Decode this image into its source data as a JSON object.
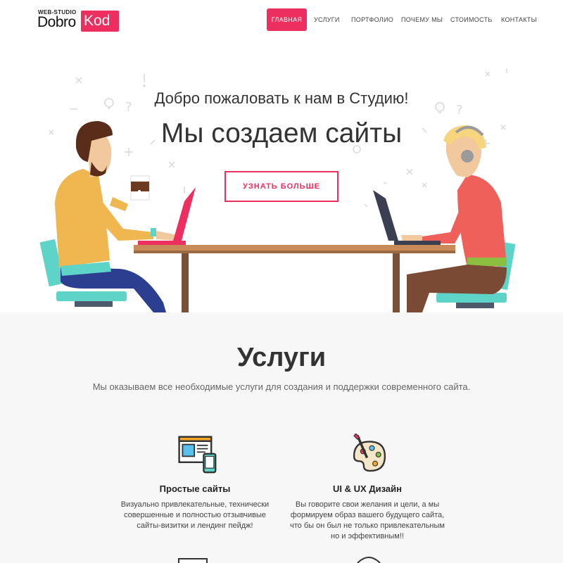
{
  "logo": {
    "small": "WEB-STUDIO",
    "dobro": "Dobro",
    "kod": "Kod"
  },
  "nav": {
    "items": [
      {
        "label": "ГЛАВНАЯ",
        "active": true
      },
      {
        "label": "УСЛУГИ"
      },
      {
        "label": "ПОРТФОЛИО"
      },
      {
        "label": "ПОЧЕМУ МЫ"
      },
      {
        "label": "СТОИМОСТЬ"
      },
      {
        "label": "КОНТАКТЫ"
      }
    ]
  },
  "hero": {
    "welcome": "Добро пожаловать к нам в Студию!",
    "title": "Мы создаем сайты",
    "button": "УЗНАТЬ БОЛЬШЕ"
  },
  "services": {
    "title": "Услуги",
    "subtitle": "Мы оказываем все необходимые услуги для создания и поддержки современного сайта.",
    "items": [
      {
        "icon": "website-devices-icon",
        "title": "Простые сайты",
        "text": "Визуально привлекательные, технически совершенные и полностью отзывчивые сайты-визитки и лендинг пейдж!"
      },
      {
        "icon": "palette-icon",
        "title": "UI & UX Дизайн",
        "text": "Вы говорите свои желания и цели, а мы формируем образ вашего будущего сайта, что бы он был не только привлекательным но и эффективным!!"
      }
    ]
  },
  "colors": {
    "accent": "#ec2f5e",
    "services_bg": "#f7f7f7"
  }
}
